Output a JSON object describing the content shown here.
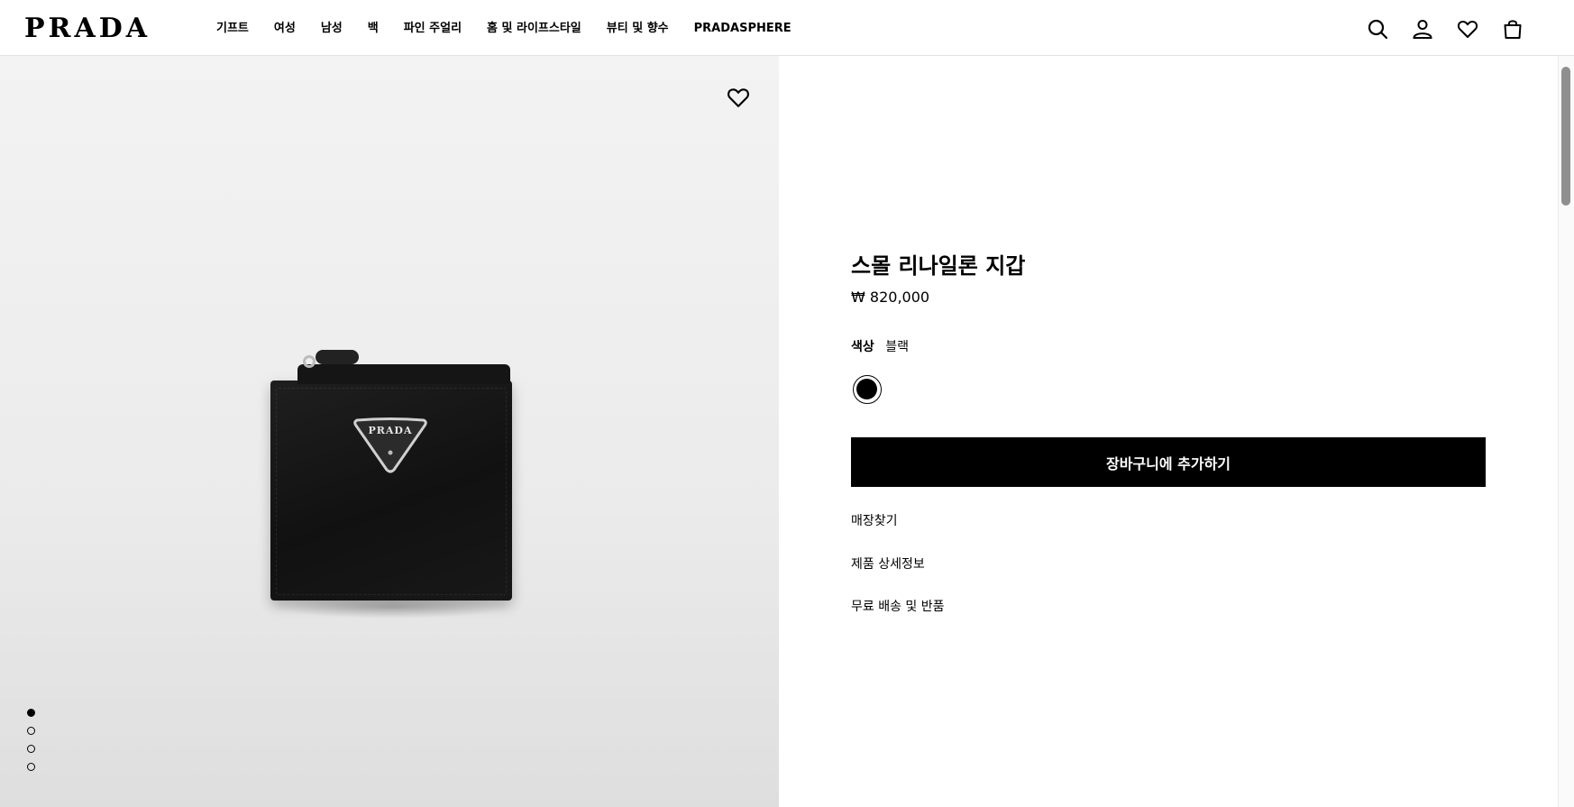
{
  "header": {
    "logo": "PRADA",
    "nav": [
      "기프트",
      "여성",
      "남성",
      "백",
      "파인 주얼리",
      "홈 및 라이프스타일",
      "뷰티 및 향수",
      "PRADASPHERE"
    ],
    "icons": [
      "search-icon",
      "account-icon",
      "wishlist-icon",
      "bag-icon"
    ]
  },
  "gallery": {
    "product_logo": "PRADA",
    "wishlist_icon": "heart-outline-icon",
    "slides": 4,
    "active_slide": 1
  },
  "product": {
    "title": "스몰 리나일론 지갑",
    "price": "₩ 820,000",
    "color_label": "색상",
    "color_value": "블랙",
    "swatch_color": "#000000",
    "add_to_cart": "장바구니에 추가하기",
    "links": [
      "매장찾기",
      "제품 상세정보",
      "무료 배송 및 반품"
    ]
  }
}
